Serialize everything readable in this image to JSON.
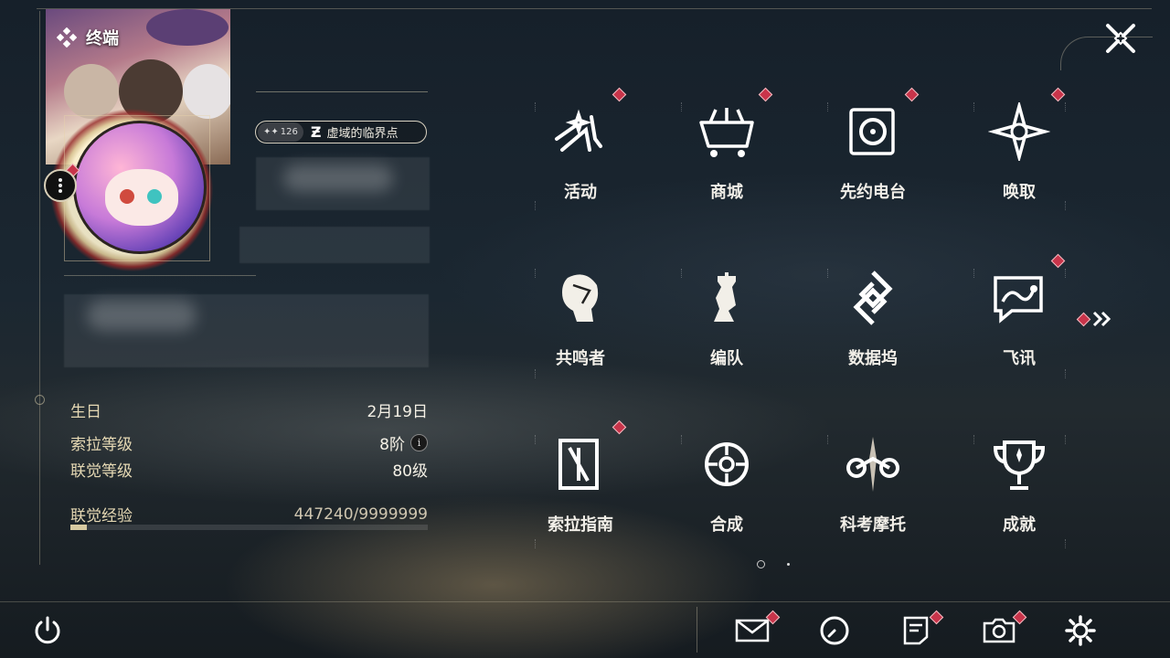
{
  "terminal": {
    "label": "终端"
  },
  "profile": {
    "title_badge_count": "126",
    "title_text": "虚域的临界点",
    "stats": [
      {
        "label": "生日",
        "value": "2月19日"
      },
      {
        "label": "索拉等级",
        "value": "8阶"
      },
      {
        "label": "联觉等级",
        "value": "80级"
      }
    ],
    "exp": {
      "label": "联觉经验",
      "value": "447240/9999999",
      "fill_fraction": 0.045
    }
  },
  "menu": [
    {
      "label": "活动",
      "icon": "activity-icon",
      "badge": true
    },
    {
      "label": "商城",
      "icon": "shop-cart-icon",
      "badge": true
    },
    {
      "label": "先约电台",
      "icon": "radio-icon",
      "badge": true
    },
    {
      "label": "唤取",
      "icon": "summon-compass-icon",
      "badge": true
    },
    {
      "label": "共鸣者",
      "icon": "resonator-icon",
      "badge": false
    },
    {
      "label": "编队",
      "icon": "team-chess-icon",
      "badge": false
    },
    {
      "label": "数据坞",
      "icon": "data-dock-icon",
      "badge": false
    },
    {
      "label": "飞讯",
      "icon": "message-icon",
      "badge": true
    },
    {
      "label": "索拉指南",
      "icon": "guide-icon",
      "badge": true
    },
    {
      "label": "合成",
      "icon": "synthesis-icon",
      "badge": false
    },
    {
      "label": "科考摩托",
      "icon": "motorbike-icon",
      "badge": false
    },
    {
      "label": "成就",
      "icon": "trophy-icon",
      "badge": false
    }
  ],
  "pagination": {
    "current": 1,
    "total": 2
  },
  "colors": {
    "badge": "#c8344a",
    "label_gold": "#e6d9b4",
    "text": "#f2efe8"
  }
}
